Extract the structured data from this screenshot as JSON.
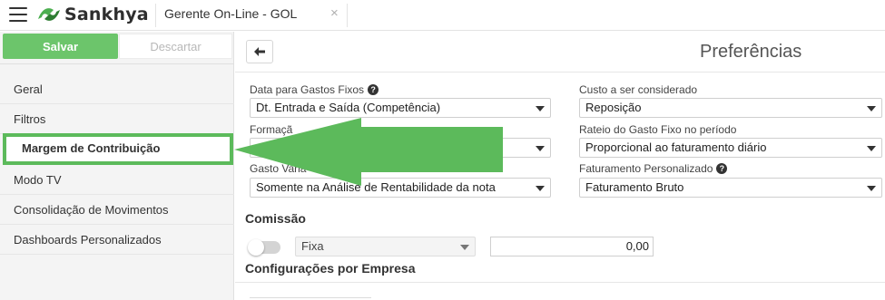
{
  "header": {
    "brand": "Sankhya",
    "tab_title": "Gerente On-Line - GOL",
    "close_icon": "×",
    "icons": [
      "hamburger-menu-icon",
      "sankhya-logo-icon",
      "close-icon"
    ]
  },
  "sidebar": {
    "save_label": "Salvar",
    "discard_label": "Descartar",
    "items": [
      {
        "label": "Geral"
      },
      {
        "label": "Filtros"
      },
      {
        "label": "Margem de Contribuição",
        "active": true
      },
      {
        "label": "Modo TV"
      },
      {
        "label": "Consolidação de Movimentos"
      },
      {
        "label": "Dashboards Personalizados"
      }
    ]
  },
  "main": {
    "title": "Preferências",
    "back_icon": "arrow-left-icon",
    "fields": {
      "gastos_fixos_label": "Data para Gastos Fixos",
      "gastos_fixos_value": "Dt. Entrada e Saída (Competência)",
      "custo_label": "Custo a ser considerado",
      "custo_value": "Reposição",
      "formacao_label": "Formaçã",
      "formacao_value": "",
      "rateio_label": "Rateio do Gasto Fixo no período",
      "rateio_value": "Proporcional ao faturamento diário",
      "gasto_var_label": "Gasto Varia",
      "gasto_var_value": "Somente na Análise de Rentabilidade da nota",
      "faturamento_label": "Faturamento Personalizado",
      "faturamento_value": "Faturamento Bruto"
    },
    "comissao": {
      "title": "Comissão",
      "type_value": "Fixa",
      "amount_value": "0,00",
      "toggle_on": false
    },
    "empresa_section_title": "Configurações por Empresa"
  },
  "colors": {
    "accent_green": "#5cba5b",
    "save_green": "#6cc56b",
    "arrow_green": "#5cba5b"
  }
}
